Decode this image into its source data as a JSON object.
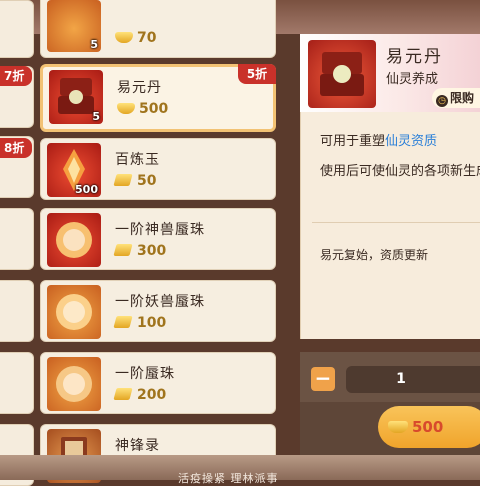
{
  "left_badges": [
    "7折",
    "8折"
  ],
  "items": [
    {
      "name": "",
      "qty": "5",
      "price": "70",
      "currency": "ingot",
      "badge": ""
    },
    {
      "name": "易元丹",
      "qty": "5",
      "price": "500",
      "currency": "ingot",
      "badge": "5折",
      "selected": true
    },
    {
      "name": "百炼玉",
      "qty": "500",
      "price": "50",
      "currency": "gold-bar",
      "badge": ""
    },
    {
      "name": "一阶神兽蜃珠",
      "qty": "",
      "price": "300",
      "currency": "gold-bar",
      "badge": ""
    },
    {
      "name": "一阶妖兽蜃珠",
      "qty": "",
      "price": "100",
      "currency": "gold-bar",
      "badge": ""
    },
    {
      "name": "一阶蜃珠",
      "qty": "",
      "price": "200",
      "currency": "gold-bar",
      "badge": ""
    },
    {
      "name": "神锋录",
      "qty": "",
      "price": "",
      "currency": "gold-bar",
      "badge": ""
    }
  ],
  "detail": {
    "name": "易元丹",
    "category": "仙灵养成",
    "limit_label": "限购",
    "desc1_prefix": "可用于重塑",
    "desc1_highlight": "仙灵资质",
    "desc2": "使用后可使仙灵的各项新生成",
    "flavor": "易元复始，资质更新"
  },
  "quantity": {
    "value": "1",
    "minus_label": "−"
  },
  "buy": {
    "price": "500"
  },
  "bottom_text": "活疫操紧    理林派事",
  "colors": {
    "accent_red": "#c9312a",
    "highlight_blue": "#2a7fd8",
    "price_gold": "#a0741d",
    "buy_button": "#f0a42b"
  }
}
